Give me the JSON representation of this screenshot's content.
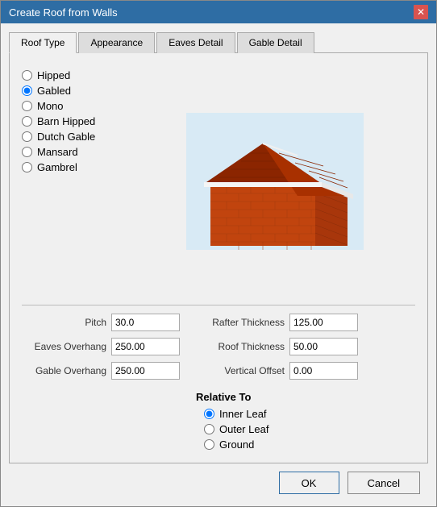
{
  "dialog": {
    "title": "Create Roof from Walls",
    "close_label": "✕"
  },
  "tabs": [
    {
      "id": "roof-type",
      "label": "Roof Type",
      "active": true
    },
    {
      "id": "appearance",
      "label": "Appearance",
      "active": false
    },
    {
      "id": "eaves-detail",
      "label": "Eaves Detail",
      "active": false
    },
    {
      "id": "gable-detail",
      "label": "Gable Detail",
      "active": false
    }
  ],
  "roof_types": [
    {
      "id": "hipped",
      "label": "Hipped",
      "checked": false
    },
    {
      "id": "gabled",
      "label": "Gabled",
      "checked": true
    },
    {
      "id": "mono",
      "label": "Mono",
      "checked": false
    },
    {
      "id": "barn-hipped",
      "label": "Barn Hipped",
      "checked": false
    },
    {
      "id": "dutch-gable",
      "label": "Dutch Gable",
      "checked": false
    },
    {
      "id": "mansard",
      "label": "Mansard",
      "checked": false
    },
    {
      "id": "gambrel",
      "label": "Gambrel",
      "checked": false
    }
  ],
  "fields": {
    "left": [
      {
        "id": "pitch",
        "label": "Pitch",
        "value": "30.0"
      },
      {
        "id": "eaves-overhang",
        "label": "Eaves Overhang",
        "value": "250.00"
      },
      {
        "id": "gable-overhang",
        "label": "Gable Overhang",
        "value": "250.00"
      }
    ],
    "right": [
      {
        "id": "rafter-thickness",
        "label": "Rafter Thickness",
        "value": "125.00"
      },
      {
        "id": "roof-thickness",
        "label": "Roof Thickness",
        "value": "50.00"
      },
      {
        "id": "vertical-offset",
        "label": "Vertical Offset",
        "value": "0.00"
      }
    ]
  },
  "relative_to": {
    "title": "Relative To",
    "options": [
      {
        "id": "inner-leaf",
        "label": "Inner Leaf",
        "checked": true
      },
      {
        "id": "outer-leaf",
        "label": "Outer Leaf",
        "checked": false
      },
      {
        "id": "ground",
        "label": "Ground",
        "checked": false
      }
    ]
  },
  "buttons": {
    "ok": "OK",
    "cancel": "Cancel"
  }
}
